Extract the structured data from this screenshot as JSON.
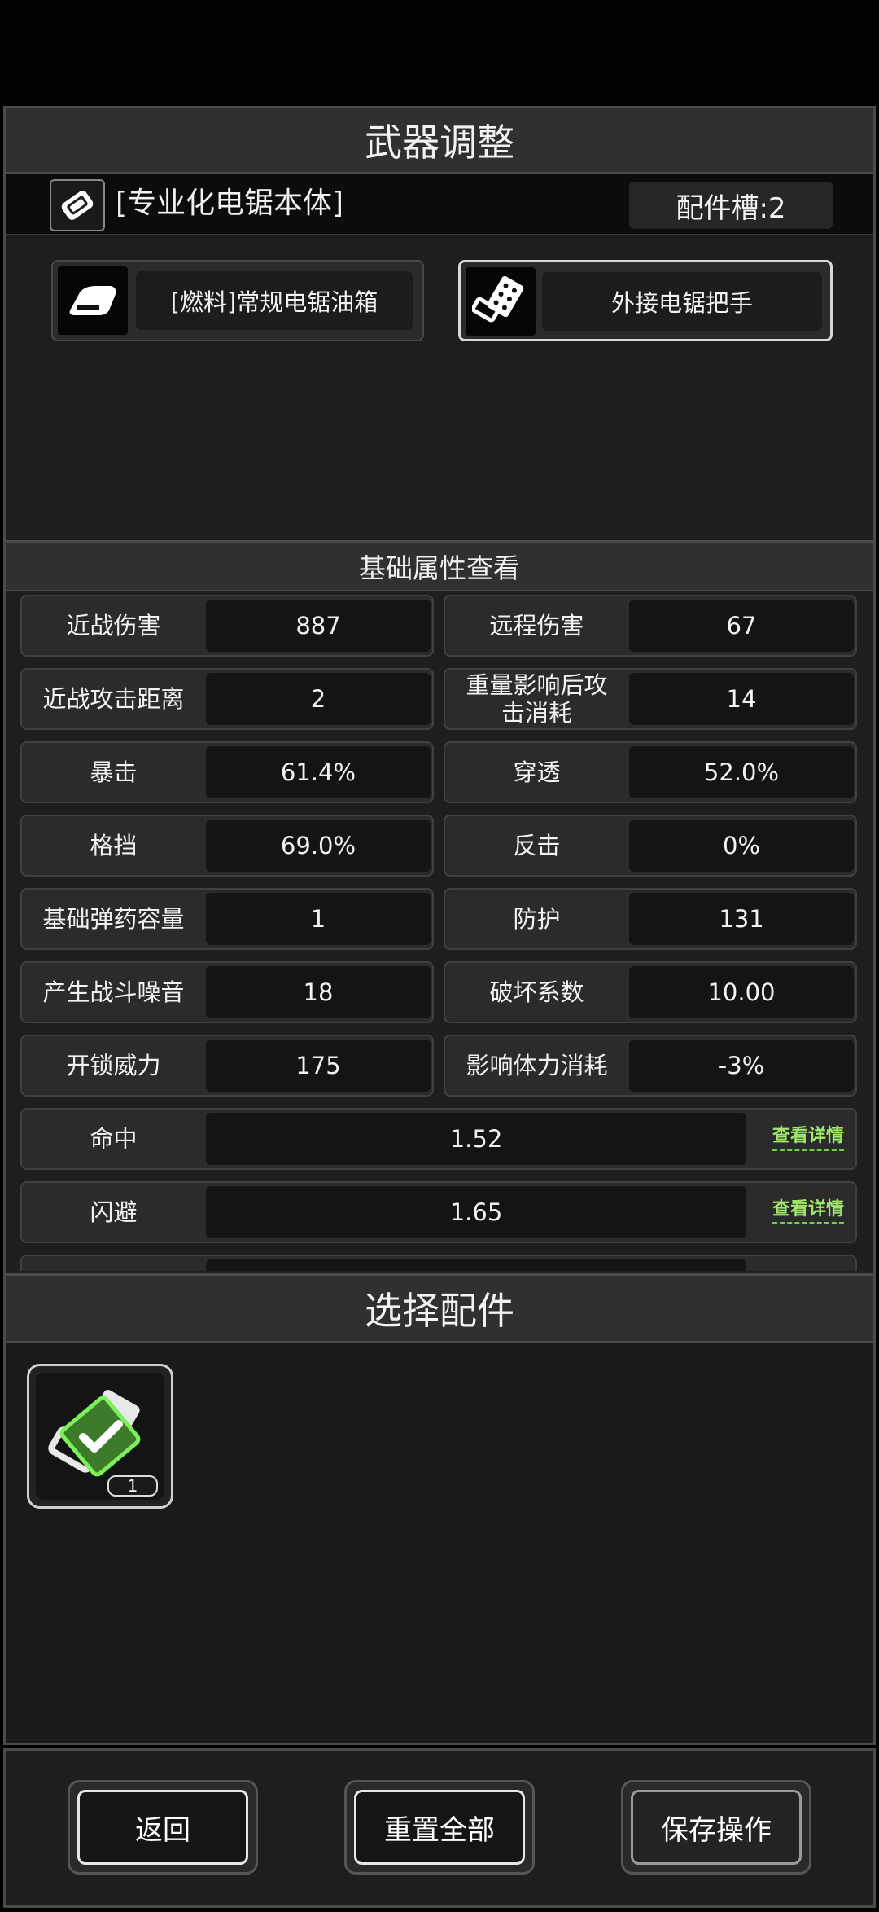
{
  "adjust": {
    "title": "武器调整",
    "weapon_name": "[专业化电锯本体]",
    "slot_label": "配件槽:2",
    "accessories": [
      {
        "label": "[燃料]常规电锯油箱",
        "icon": "fuel-tank-icon",
        "selected": false
      },
      {
        "label": "外接电锯把手",
        "icon": "saw-handle-icon",
        "selected": true
      }
    ]
  },
  "attributes": {
    "title": "基础属性查看",
    "pairs": [
      {
        "l_label": "近战伤害",
        "l_value": "887",
        "r_label": "远程伤害",
        "r_value": "67"
      },
      {
        "l_label": "近战攻击距离",
        "l_value": "2",
        "r_label": "重量影响后攻击消耗",
        "r_value": "14"
      },
      {
        "l_label": "暴击",
        "l_value": "61.4%",
        "r_label": "穿透",
        "r_value": "52.0%"
      },
      {
        "l_label": "格挡",
        "l_value": "69.0%",
        "r_label": "反击",
        "r_value": "0%"
      },
      {
        "l_label": "基础弹药容量",
        "l_value": "1",
        "r_label": "防护",
        "r_value": "131"
      },
      {
        "l_label": "产生战斗噪音",
        "l_value": "18",
        "r_label": "破坏系数",
        "r_value": "10.00"
      },
      {
        "l_label": "开锁威力",
        "l_value": "175",
        "r_label": "影响体力消耗",
        "r_value": "-3%"
      }
    ],
    "wide": [
      {
        "label": "命中",
        "value": "1.52",
        "detail": "查看详情"
      },
      {
        "label": "闪避",
        "value": "1.65",
        "detail": "查看详情"
      }
    ]
  },
  "choose": {
    "title": "选择配件",
    "item": {
      "icon": "saw-handle-icon",
      "count": "1",
      "equipped": true
    }
  },
  "buttons": {
    "back": "返回",
    "reset": "重置全部",
    "save": "保存操作"
  },
  "colors": {
    "accent_green": "#9fe86a",
    "selected_border": "#d8d8d8"
  }
}
